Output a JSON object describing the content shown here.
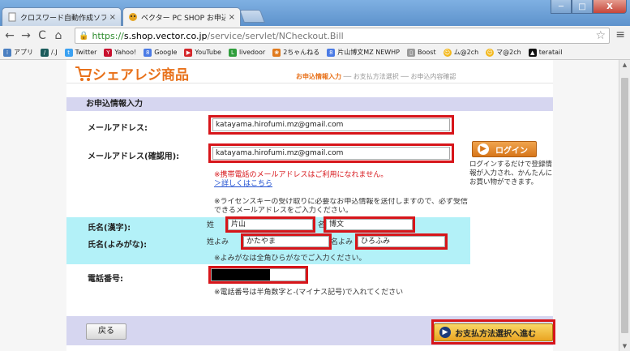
{
  "browser": {
    "tabs": [
      {
        "title": "クロスワード自動作成ソフト[",
        "active": false
      },
      {
        "title": "ベクター PC SHOP お申込み",
        "active": true
      }
    ],
    "url_scheme": "https://",
    "url_host": "s.shop.vector.co.jp",
    "url_path": "/service/servlet/NCheckout.Bill",
    "bookmarks": [
      {
        "label": "アプリ",
        "icon": "apps-icon",
        "color": "#4a7fc1"
      },
      {
        "label": "/.J",
        "icon": "slashdot-icon",
        "color": "#1b5b5b"
      },
      {
        "label": "Twitter",
        "icon": "twitter-icon",
        "color": "#3aa1f2"
      },
      {
        "label": "Yahoo!",
        "icon": "yahoo-icon",
        "color": "#c8102e"
      },
      {
        "label": "Google",
        "icon": "google-icon",
        "color": "#4b7be5"
      },
      {
        "label": "YouTube",
        "icon": "youtube-icon",
        "color": "#d4262a"
      },
      {
        "label": "livedoor",
        "icon": "livedoor-icon",
        "color": "#2f9e3c"
      },
      {
        "label": "2ちゃんねる",
        "icon": "2ch-icon",
        "color": "#e07a1d"
      },
      {
        "label": "片山博文MZ NEWHP",
        "icon": "google-icon",
        "color": "#4b7be5"
      },
      {
        "label": "Boost",
        "icon": "page-icon",
        "color": "#9a9a9a"
      },
      {
        "label": "ム@2ch",
        "icon": "face-icon",
        "color": "#f3b81c"
      },
      {
        "label": "マ@2ch",
        "icon": "face-icon",
        "color": "#f3b81c"
      },
      {
        "label": "teratail",
        "icon": "teratail-icon",
        "color": "#111111"
      }
    ]
  },
  "page": {
    "logo_text": "シェアレジ商品",
    "steps": {
      "current": "お申込情報入力",
      "sep1": " ── ",
      "step2": "お支払方法選択",
      "sep2": " ── ",
      "step3": "お申込内容確認"
    },
    "form_title": "お申込情報入力",
    "email_label": "メールアドレス:",
    "email_value": "katayama.hirofumi.mz@gmail.com",
    "email_confirm_label": "メールアドレス(確認用):",
    "email_confirm_value": "katayama.hirofumi.mz@gmail.com",
    "mobile_warning": "※携帯電話のメールアドレスはご利用になれません。",
    "details_link": "＞詳しくはこちら",
    "license_note": "※ライセンスキーの受け取りに必要なお申込情報を送付しますので、必ず受信できるメールアドレスをご入力ください。",
    "name_kanji_label": "氏名(漢字):",
    "sei_label": "姓",
    "sei_value": "片山",
    "mei_label": "名",
    "mei_value": "博文",
    "name_kana_label": "氏名(よみがな):",
    "sei_kana_label": "姓よみ",
    "sei_kana_value": "かたやま",
    "mei_kana_label": "名よみ",
    "mei_kana_value": "ひろふみ",
    "kana_note": "※よみがなは全角ひらがなでご入力ください。",
    "phone_label": "電話番号:",
    "phone_note": "※電話番号は半角数字と-(マイナス記号)で入れてください",
    "login_button": "ログイン",
    "login_note": "ログインするだけで登録情報が入力され、かんたんにお買い物ができます。",
    "back_button": "戻る",
    "next_button": "お支払方法選択へ進む"
  },
  "colors": {
    "accent_orange": "#e8711a",
    "highlight_red": "#d7151a",
    "section_lavender": "#d6d6f0",
    "name_cyan": "#b3f1f8"
  }
}
